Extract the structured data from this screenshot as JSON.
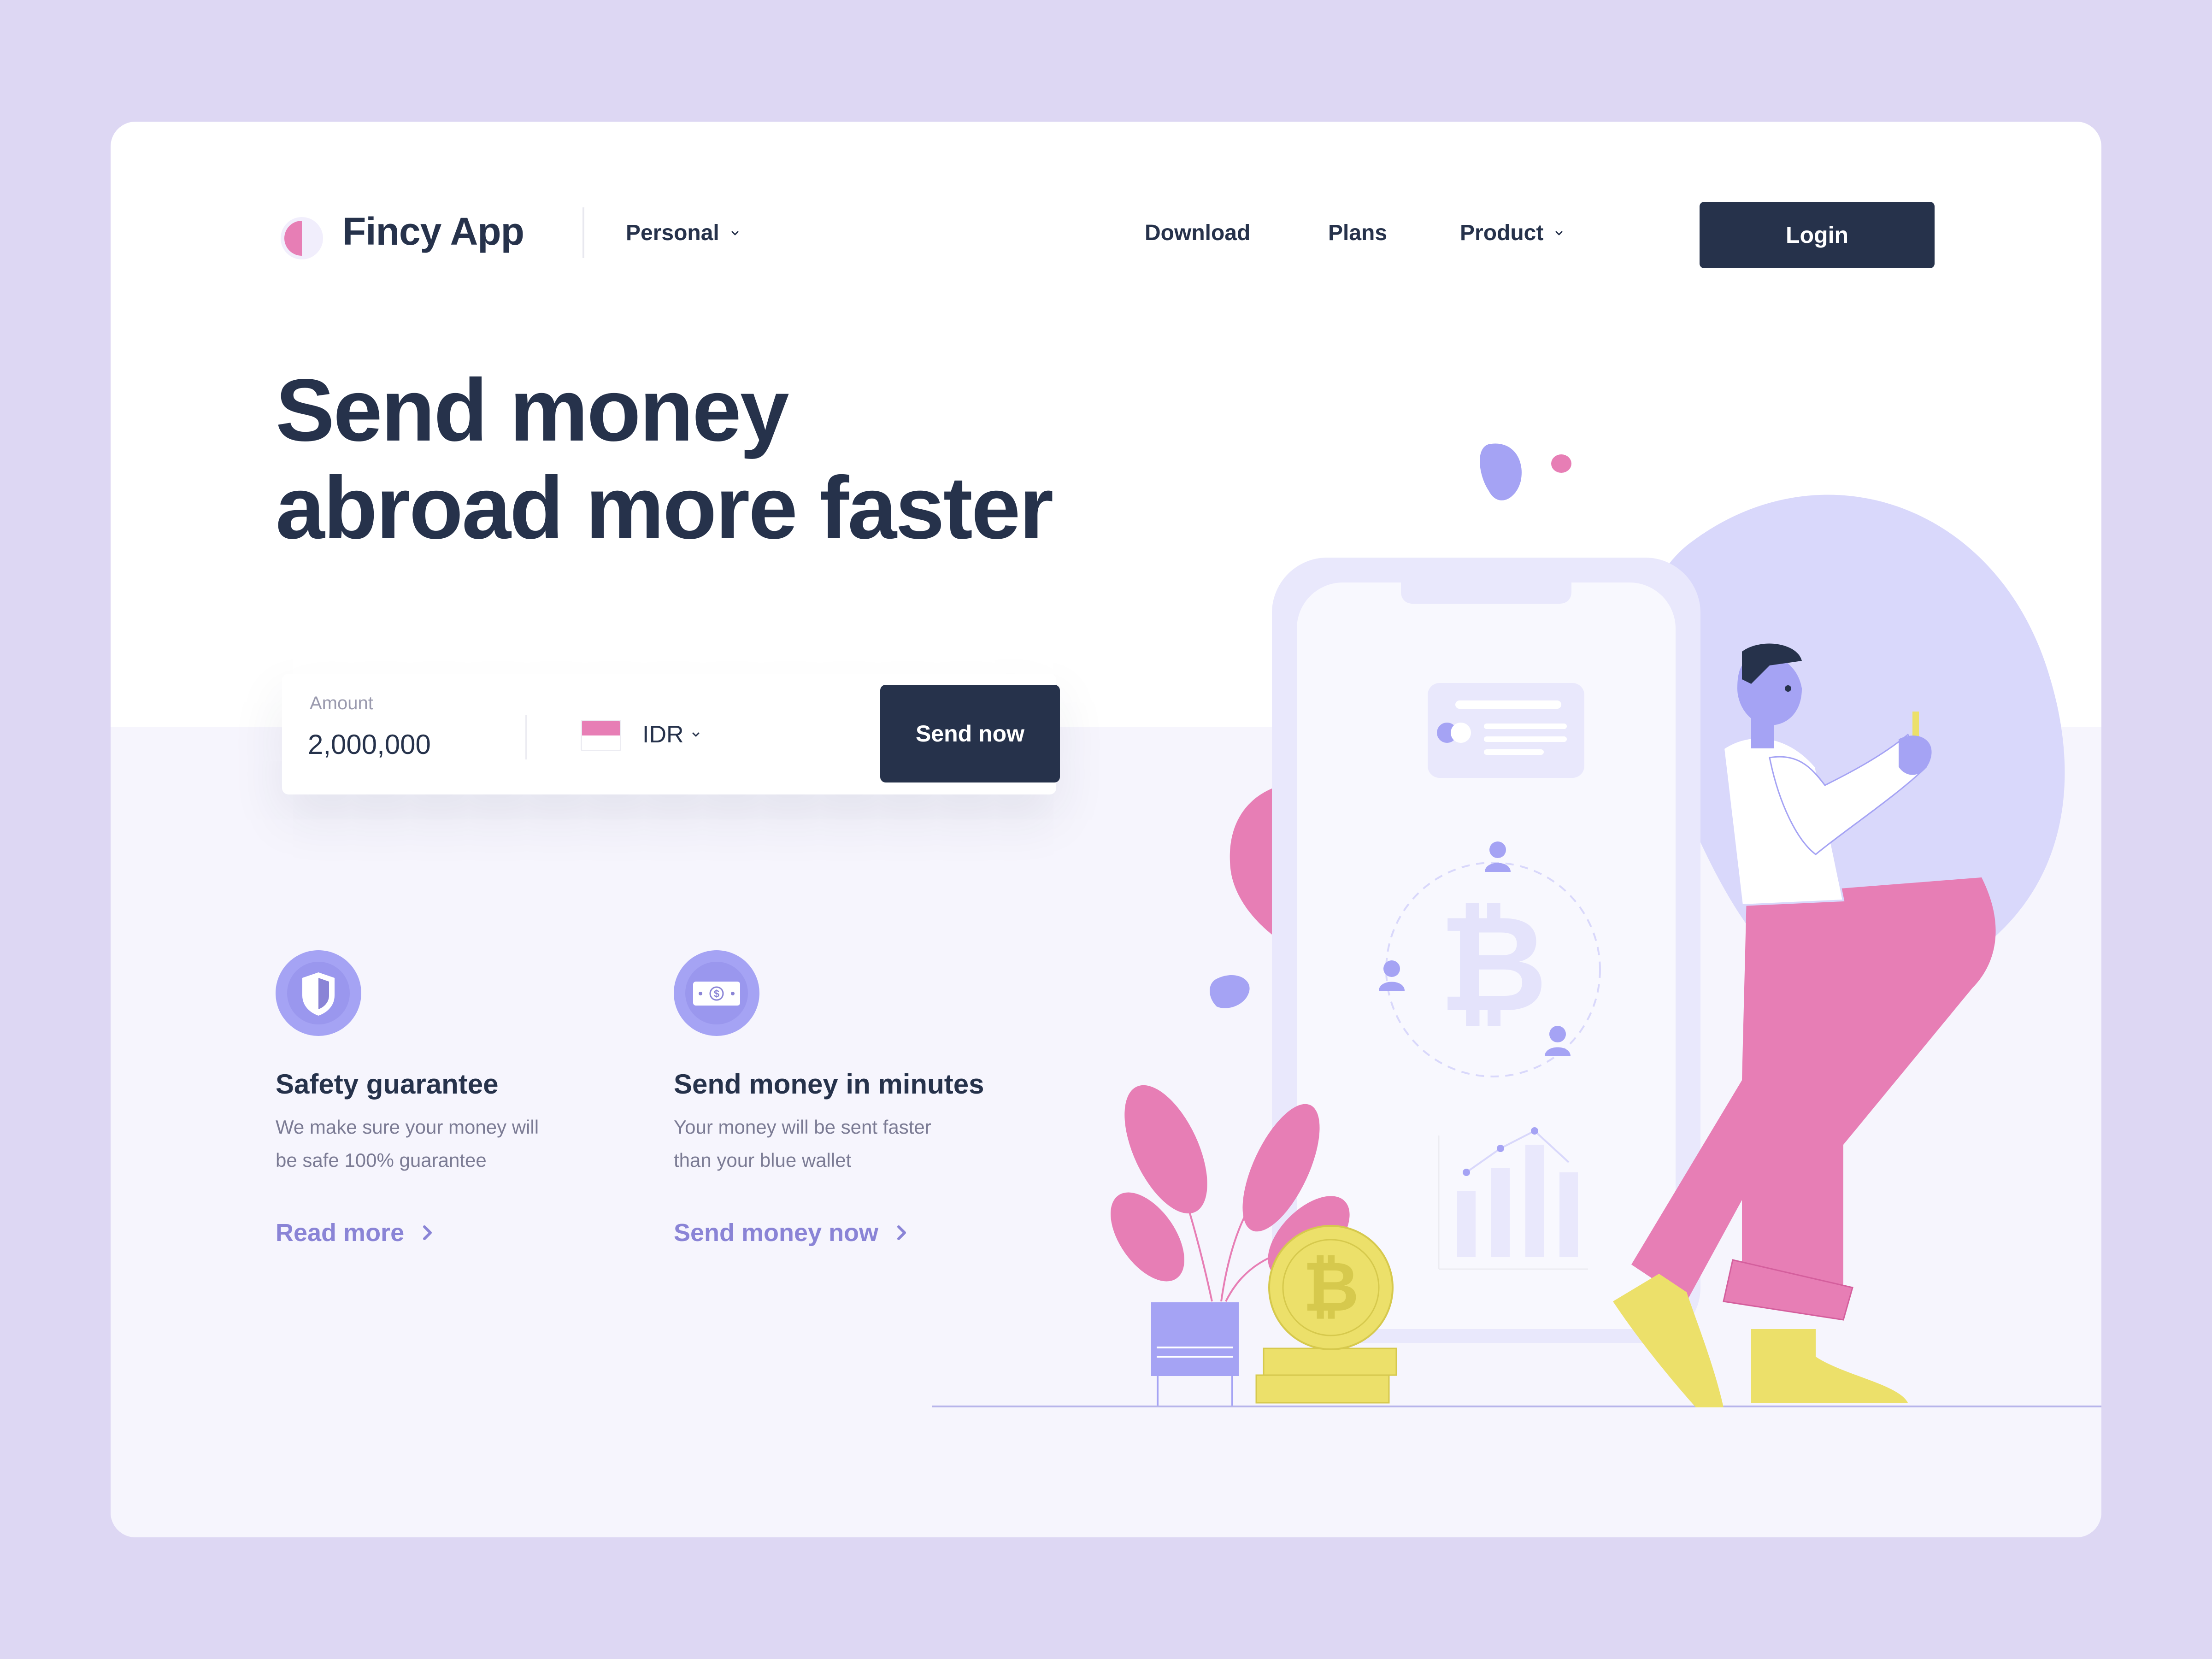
{
  "brand": {
    "name": "Fincy App",
    "accent": "#e77eb5",
    "dark": "#26324b",
    "purple": "#a5a3f4"
  },
  "nav": {
    "personal": "Personal",
    "download": "Download",
    "plans": "Plans",
    "product": "Product",
    "login": "Login"
  },
  "hero": {
    "line1": "Send money",
    "line2": "abroad more faster"
  },
  "transfer": {
    "amount_label": "Amount",
    "amount_value": "2,000,000",
    "currency": "IDR",
    "send_label": "Send now"
  },
  "features": [
    {
      "title": "Safety guarantee",
      "desc_line1": "We make sure your money will",
      "desc_line2": "be safe 100% guarantee",
      "link": "Read more",
      "icon": "shield-icon"
    },
    {
      "title": "Send money in minutes",
      "desc_line1": "Your money will be sent faster",
      "desc_line2": "than your blue wallet",
      "link": "Send money now",
      "icon": "money-bill-icon"
    }
  ]
}
